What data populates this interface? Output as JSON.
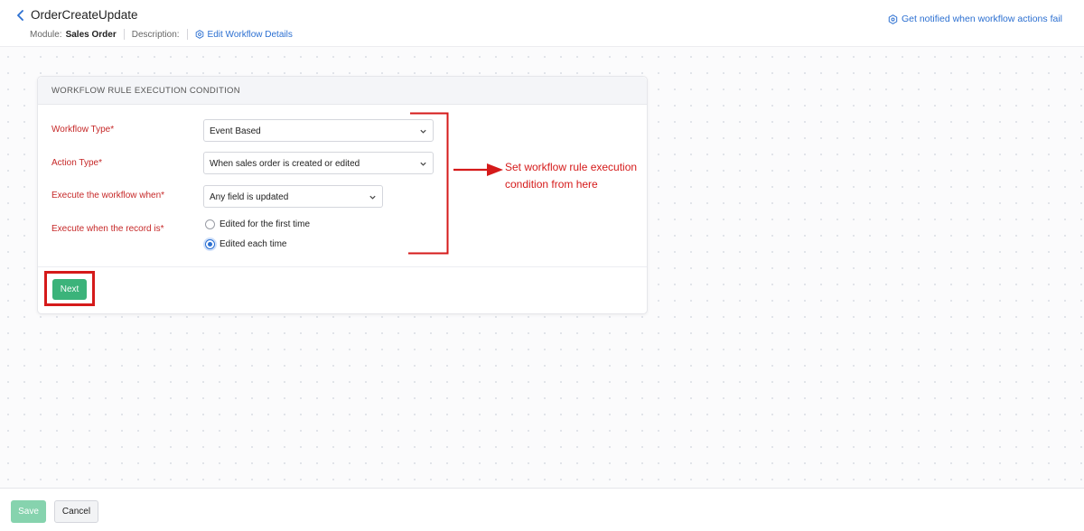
{
  "header": {
    "title": "OrderCreateUpdate",
    "module_label": "Module:",
    "module_value": "Sales Order",
    "description_label": "Description:",
    "edit_link": "Edit Workflow Details",
    "notify_link": "Get notified when workflow actions fail"
  },
  "card": {
    "heading": "WORKFLOW RULE EXECUTION CONDITION",
    "fields": {
      "workflow_type_label": "Workflow Type*",
      "workflow_type_value": "Event Based",
      "action_type_label": "Action Type*",
      "action_type_value": "When sales order is created or edited",
      "execute_when_label": "Execute the workflow when*",
      "execute_when_value": "Any field is updated",
      "record_is_label": "Execute when the record is*",
      "options": [
        {
          "label": "Edited for the first time",
          "selected": false
        },
        {
          "label": "Edited each time",
          "selected": true
        }
      ]
    },
    "next_label": "Next"
  },
  "annotation": {
    "text": "Set workflow rule execution condition from here",
    "color": "#d51a1a"
  },
  "footer": {
    "save_label": "Save",
    "cancel_label": "Cancel"
  },
  "colors": {
    "accent": "#2b6fd1",
    "primary_button": "#3bb37a",
    "required_label": "#c62828"
  }
}
